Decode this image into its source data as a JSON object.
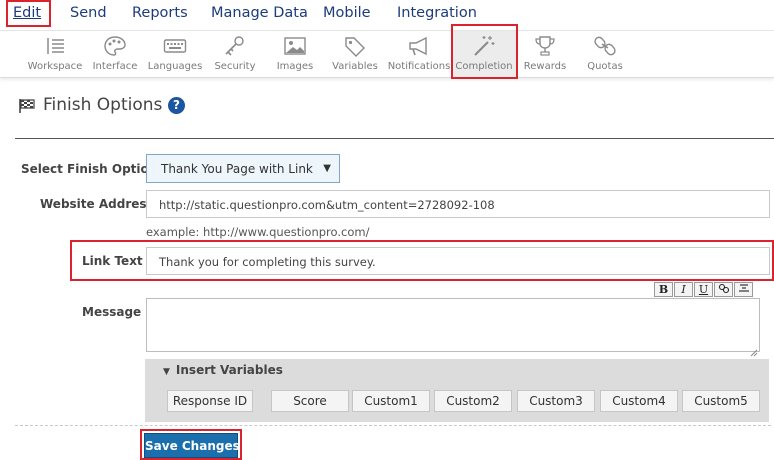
{
  "top_menu": [
    {
      "label": "Edit",
      "active": true
    },
    {
      "label": "Send",
      "active": false
    },
    {
      "label": "Reports",
      "active": false
    },
    {
      "label": "Manage Data",
      "active": false
    },
    {
      "label": "Mobile",
      "active": false
    },
    {
      "label": "Integration",
      "active": false
    }
  ],
  "toolbar": [
    {
      "label": "Workspace",
      "icon": "workspace-icon"
    },
    {
      "label": "Interface",
      "icon": "palette-icon"
    },
    {
      "label": "Languages",
      "icon": "keyboard-icon"
    },
    {
      "label": "Security",
      "icon": "key-icon"
    },
    {
      "label": "Images",
      "icon": "image-icon"
    },
    {
      "label": "Variables",
      "icon": "tag-icon"
    },
    {
      "label": "Notifications",
      "icon": "megaphone-icon"
    },
    {
      "label": "Completion",
      "icon": "magic-wand-icon",
      "active": true
    },
    {
      "label": "Rewards",
      "icon": "trophy-icon"
    },
    {
      "label": "Quotas",
      "icon": "chain-icon"
    }
  ],
  "page": {
    "title": "Finish Options",
    "help": "?"
  },
  "form": {
    "finish_option_label": "Select Finish Option",
    "finish_option_value": "Thank You Page with Link",
    "website_label": "Website Address",
    "website_value": "http://static.questionpro.com&utm_content=2728092-108",
    "website_example": "example: http://www.questionpro.com/",
    "link_text_label": "Link Text",
    "link_text_value": "Thank you for completing this survey.",
    "message_label": "Message",
    "message_value": "",
    "rte_buttons": [
      {
        "label": "B",
        "name": "bold-button"
      },
      {
        "label": "I",
        "name": "italic-button"
      },
      {
        "label": "U",
        "name": "underline-button"
      },
      {
        "label": "",
        "name": "link-button"
      },
      {
        "label": "",
        "name": "align-center-button"
      }
    ]
  },
  "insert_variables": {
    "label": "Insert Variables",
    "buttons": [
      "Response ID",
      "Score",
      "Custom1",
      "Custom2",
      "Custom3",
      "Custom4",
      "Custom5"
    ]
  },
  "save_label": "Save Changes",
  "colors": {
    "menu_text": "#1d3c7a",
    "highlight": "#d9232d",
    "primary_button": "#1c6fad",
    "help_icon": "#1c56a3"
  }
}
